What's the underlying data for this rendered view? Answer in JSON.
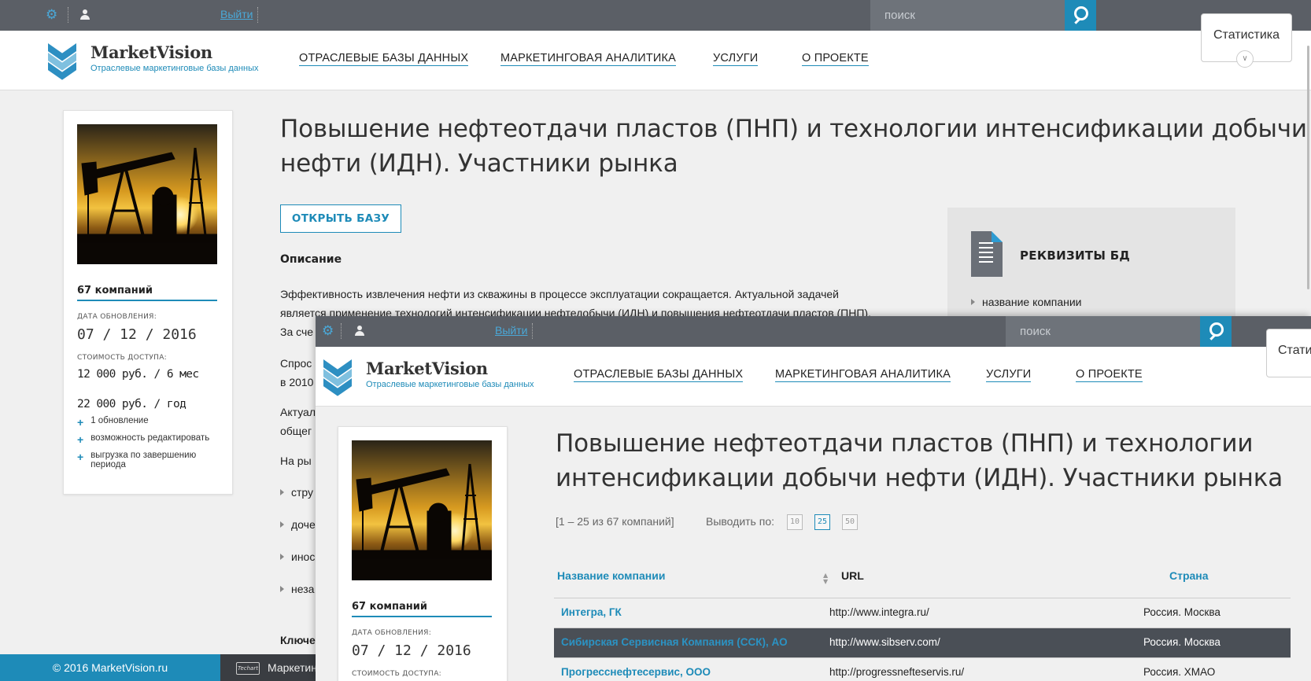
{
  "topbar": {
    "logout": "Выйти",
    "search_placeholder": "поиск"
  },
  "logo": {
    "name": "MarketVision",
    "tagline": "Отраслевые маркетинговые базы данных"
  },
  "nav": [
    "ОТРАСЛЕВЫЕ БАЗЫ ДАННЫХ",
    "МАРКЕТИНГОВАЯ АНАЛИТИКА",
    "УСЛУГИ",
    "О ПРОЕКТЕ"
  ],
  "stat_button": "Статистика",
  "stat_button_cut": "Стати",
  "sidebar": {
    "companies": "67 компаний",
    "update_label": "ДАТА ОБНОВЛЕНИЯ:",
    "update_date": "07 / 12 / 2016",
    "price_label": "СТОИМОСТЬ ДОСТУПА:",
    "price_6m": "12 000 руб. / 6 мес",
    "price_year": "22 000 руб. / год",
    "features": [
      "1 обновление",
      "возможность редактировать",
      "выгрузка по завершению периода"
    ]
  },
  "page": {
    "title_line1": "Повышение нефтеотдачи пластов (ПНП) и технологии интенсификации добычи",
    "title_line2": "нефти (ИДН). Участники рынка",
    "title2_line1": "Повышение нефтеотдачи пластов (ПНП) и технологии",
    "title2_line2": "интенсификации добычи нефти (ИДН). Участники рынка",
    "open_button": "ОТКРЫТЬ БАЗУ",
    "desc_heading": "Описание",
    "desc_line1": "Эффективность извлечения нефти из скважины в процессе эксплуатации сокращается. Актуальной задачей",
    "desc_line2": "является применение технологий интенсификации нефтедобычи (ИДН) и повышения нефтеотдачи пластов (ПНП).",
    "desc_line3": "За сче",
    "para2_line1": "Спрос",
    "para2_line2": "в 2010",
    "para3_line1": "Актуал",
    "para3_line2": "общег",
    "para4": "На ры",
    "bullets": [
      "стру",
      "доче",
      "инос",
      "неза"
    ],
    "key_heading": "Ключе"
  },
  "requisites": {
    "title": "РЕКВИЗИТЫ БД",
    "item": "название компании"
  },
  "footer": {
    "copyright": "© 2016 MarketVision.ru",
    "techart": "Techart",
    "marketing": "Маркетин"
  },
  "table": {
    "range": "[1 – 25 из 67 компаний]",
    "per_page_label": "Выводить по:",
    "per_page_options": [
      "10",
      "25",
      "50"
    ],
    "per_page_selected": "25",
    "columns": [
      "Название компании",
      "URL",
      "Страна"
    ],
    "rows": [
      {
        "name": "Интегра, ГК",
        "url": "http://www.integra.ru/",
        "country": "Россия. Москва"
      },
      {
        "name": "Сибирская Сервисная Компания (ССК), АО",
        "url": "http://www.sibserv.com/",
        "country": "Россия. Москва"
      },
      {
        "name": "Прогресснефтесервис, ООО",
        "url": "http://progressnefteservis.ru/",
        "country": "Россия. ХМАО"
      }
    ]
  },
  "colors": {
    "accent": "#1e8bb8",
    "topbar": "#5b5f66",
    "selected_row": "#4a4f56",
    "background": "#f0f0f0"
  },
  "icons": [
    "gear-icon",
    "user-icon",
    "search-icon",
    "chevron-down-icon",
    "document-icon",
    "plus-icon",
    "sort-icon"
  ]
}
